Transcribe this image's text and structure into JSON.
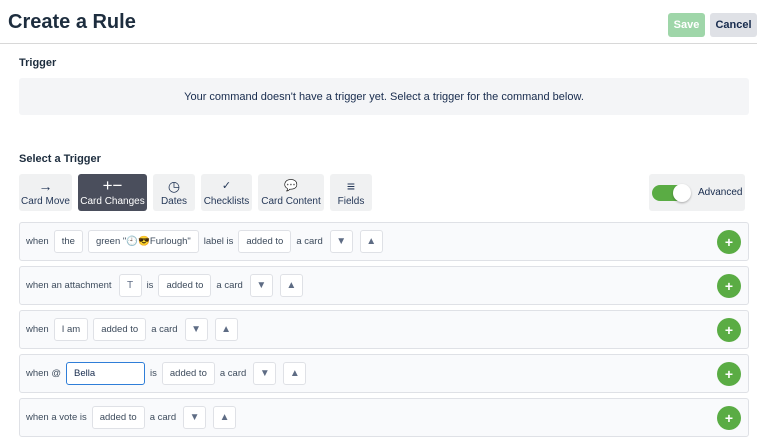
{
  "header": {
    "title": "Create a Rule",
    "save": "Save",
    "cancel": "Cancel"
  },
  "trigger": {
    "heading": "Trigger",
    "empty_message": "Your command doesn't have a trigger yet. Select a trigger for the command below."
  },
  "select": {
    "heading": "Select a Trigger",
    "tabs": [
      {
        "label": "Card Move",
        "icon": "→"
      },
      {
        "label": "Card Changes",
        "icon": "+−"
      },
      {
        "label": "Dates",
        "icon": "◷"
      },
      {
        "label": "Checklists",
        "icon": "✓"
      },
      {
        "label": "Card Content",
        "icon": "💬"
      },
      {
        "label": "Fields",
        "icon": "≡"
      }
    ],
    "advanced": {
      "label": "Advanced",
      "on": true
    }
  },
  "rows": [
    {
      "when": "when",
      "the": "the",
      "label_chip": "green \"🕘😎Furlough\"",
      "label_is": "label is",
      "action": "added to",
      "target": "a card"
    },
    {
      "when": "when an attachment",
      "is": "is",
      "action": "added to",
      "target": "a card"
    },
    {
      "when": "when",
      "who": "I am",
      "action": "added to",
      "target": "a card"
    },
    {
      "when": "when @",
      "input": "Bella",
      "is": "is",
      "action": "added to",
      "target": "a card"
    },
    {
      "when": "when a vote is",
      "action": "added to",
      "target": "a card"
    }
  ],
  "icons": {
    "filter": "▼",
    "person": "▲",
    "add": "+",
    "text": "T"
  }
}
